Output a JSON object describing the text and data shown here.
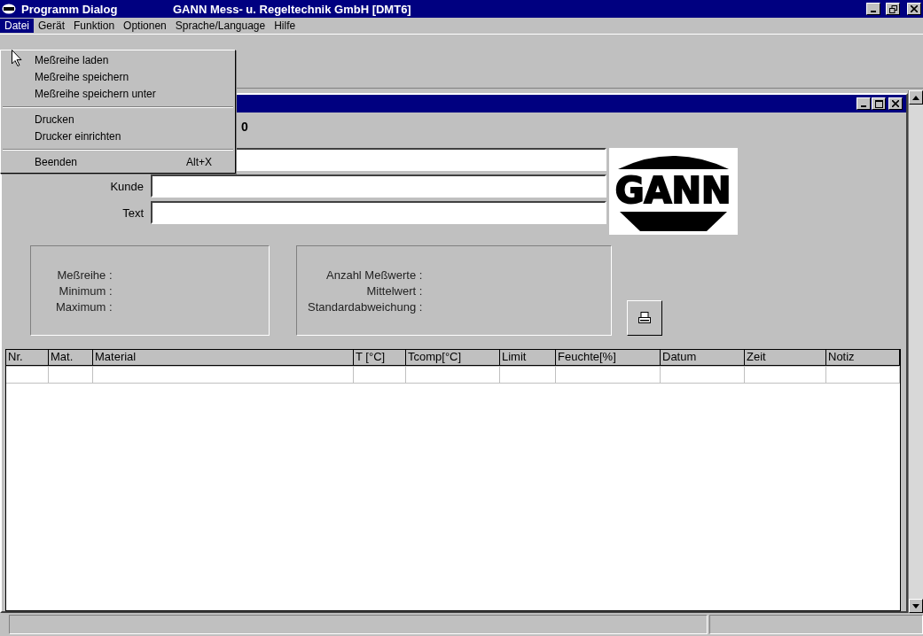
{
  "window": {
    "app_title": "Programm Dialog",
    "title": "GANN Mess- u. Regeltechnik GmbH [DMT6]"
  },
  "menu_bar": [
    {
      "label": "Datei",
      "selected": true
    },
    {
      "label": "Gerät",
      "selected": false
    },
    {
      "label": "Funktion",
      "selected": false
    },
    {
      "label": "Optionen",
      "selected": false
    },
    {
      "label": "Sprache/Language",
      "selected": false
    },
    {
      "label": "Hilfe",
      "selected": false
    }
  ],
  "dropdown": [
    {
      "kind": "item",
      "label": "Meßreihe laden"
    },
    {
      "kind": "item",
      "label": "Meßreihe speichern"
    },
    {
      "kind": "item",
      "label": "Meßreihe speichern unter"
    },
    {
      "kind": "separator"
    },
    {
      "kind": "item",
      "label": "Drucken"
    },
    {
      "kind": "item",
      "label": "Drucker einrichten"
    },
    {
      "kind": "separator"
    },
    {
      "kind": "item",
      "label": "Beenden",
      "shortcut": "Alt+X"
    }
  ],
  "child_window": {
    "header_value": "0",
    "fields": [
      {
        "kind": "bare"
      },
      {
        "kind": "labeled",
        "label": "Kunde"
      },
      {
        "kind": "labeled",
        "label": "Text"
      }
    ],
    "stats_left": [
      "Meßreihe :",
      "Minimum :",
      "Maximum :"
    ],
    "stats_right": [
      "Anzahl Meßwerte :",
      "Mittelwert :",
      "Standardabweichung :"
    ],
    "table": {
      "columns": [
        "Nr.",
        "Mat.",
        "Material",
        "T [°C]",
        "Tcomp[°C]",
        "Limit",
        "Feuchte[%]",
        "Datum",
        "Zeit",
        "Notiz"
      ]
    }
  },
  "logo": {
    "text": "GANN"
  }
}
